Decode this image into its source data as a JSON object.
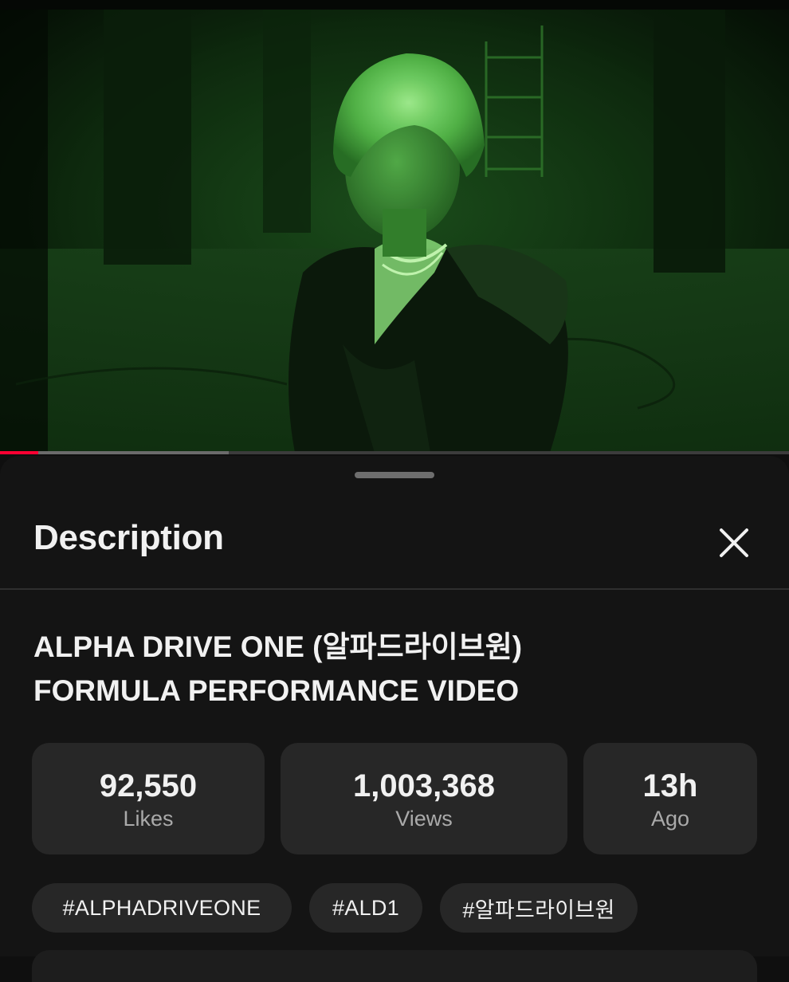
{
  "sheet": {
    "title": "Description",
    "close_icon": "close-icon"
  },
  "video": {
    "progress_played": 0.048,
    "progress_buffered": 0.29,
    "progress_color": "#ff0033",
    "tint_color": "#2f8f2f"
  },
  "details": {
    "title_line1": "ALPHA DRIVE ONE (알파드라이브원)",
    "title_line2": "FORMULA PERFORMANCE VIDEO"
  },
  "stats": [
    {
      "value": "92,550",
      "label": "Likes"
    },
    {
      "value": "1,003,368",
      "label": "Views"
    },
    {
      "value": "13h",
      "label": "Ago"
    }
  ],
  "hashtags": [
    "#ALPHADRIVEONE",
    "#ALD1",
    "#알파드라이브원"
  ]
}
